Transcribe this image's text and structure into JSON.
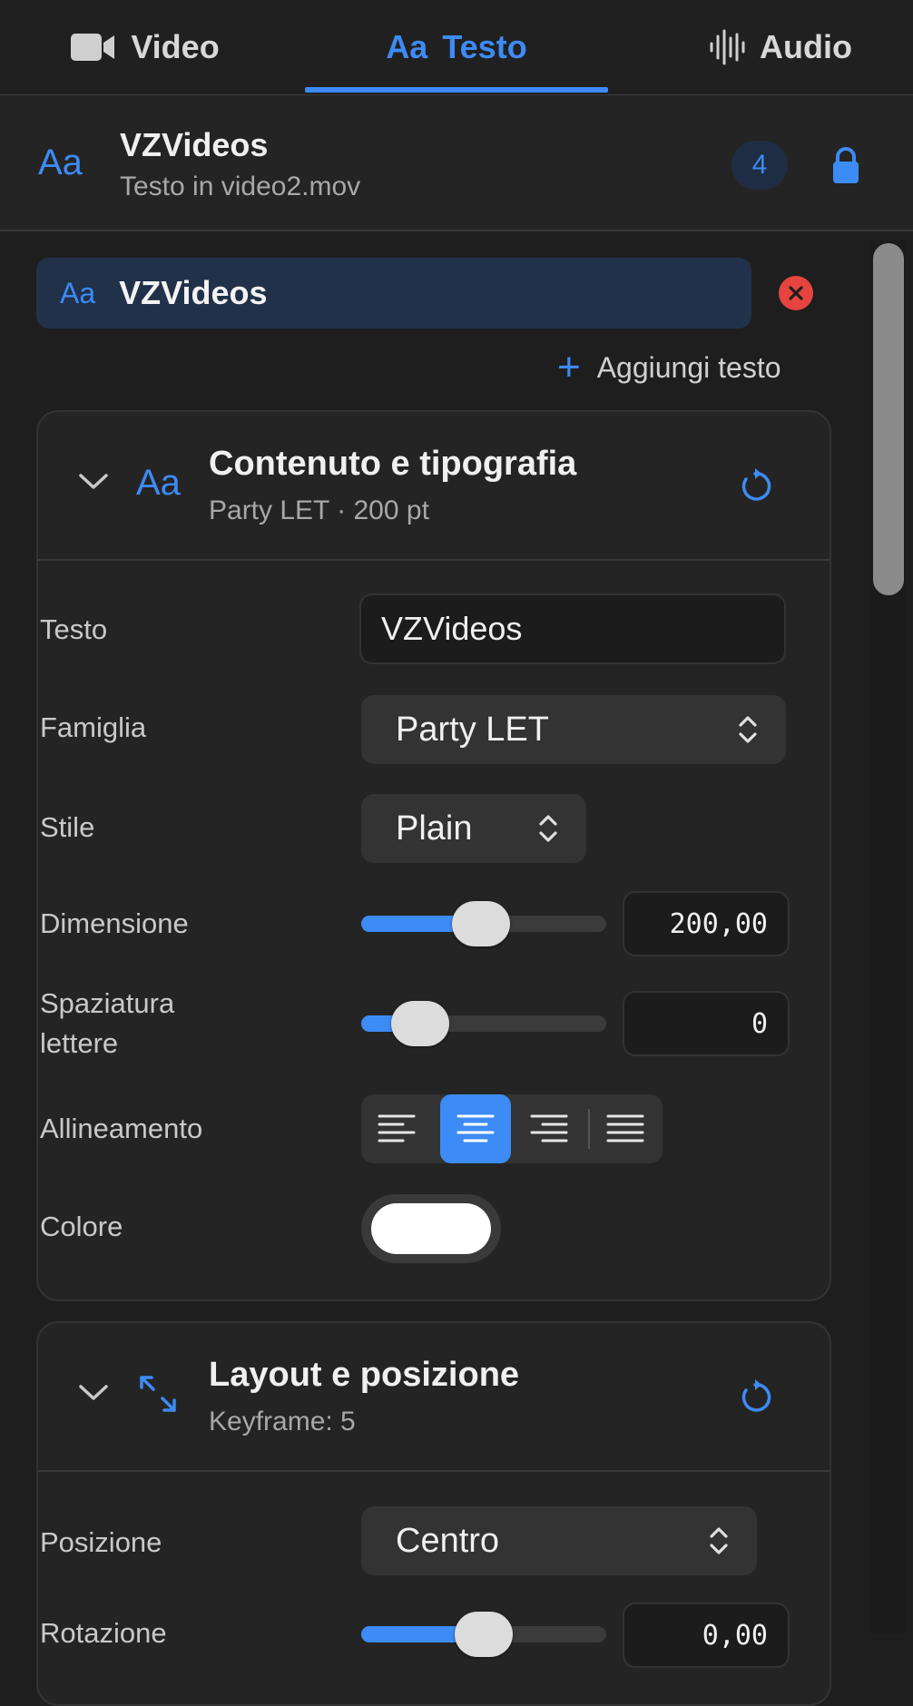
{
  "tabs": [
    {
      "label": "Video",
      "icon": "video-camera-icon"
    },
    {
      "label": "Testo",
      "icon_text": "Aa",
      "active": true
    },
    {
      "label": "Audio",
      "icon": "waveform-icon"
    }
  ],
  "header": {
    "icon_text": "Aa",
    "title": "VZVideos",
    "subtitle": "Testo in video2.mov",
    "badge_count": "4"
  },
  "layer": {
    "icon_text": "Aa",
    "name": "VZVideos"
  },
  "add_text": {
    "plus": "+",
    "label": "Aggiungi testo"
  },
  "typography": {
    "icon_text": "Aa",
    "title": "Contenuto e tipografia",
    "subtitle": "Party LET · 200 pt",
    "labels": {
      "text": "Testo",
      "family": "Famiglia",
      "style": "Stile",
      "size": "Dimensione",
      "spacing_line1": "Spaziatura",
      "spacing_line2": "lettere",
      "alignment": "Allineamento",
      "color": "Colore"
    },
    "text_value": "VZVideos",
    "family_value": "Party LET",
    "style_value": "Plain",
    "size_value": "200,00",
    "size_slider_fraction": 0.49,
    "spacing_value": "0",
    "spacing_slider_fraction": 0.24,
    "alignment_selected": "center",
    "color_value": "#ffffff"
  },
  "layout": {
    "title": "Layout e posizione",
    "subtitle": "Keyframe: 5",
    "labels": {
      "position": "Posizione",
      "rotation": "Rotazione"
    },
    "position_value": "Centro",
    "rotation_value": "0,00",
    "rotation_slider_fraction": 0.5
  },
  "colors": {
    "accent": "#3d8bf5",
    "background": "#1e1e1e",
    "danger": "#e5443f"
  }
}
